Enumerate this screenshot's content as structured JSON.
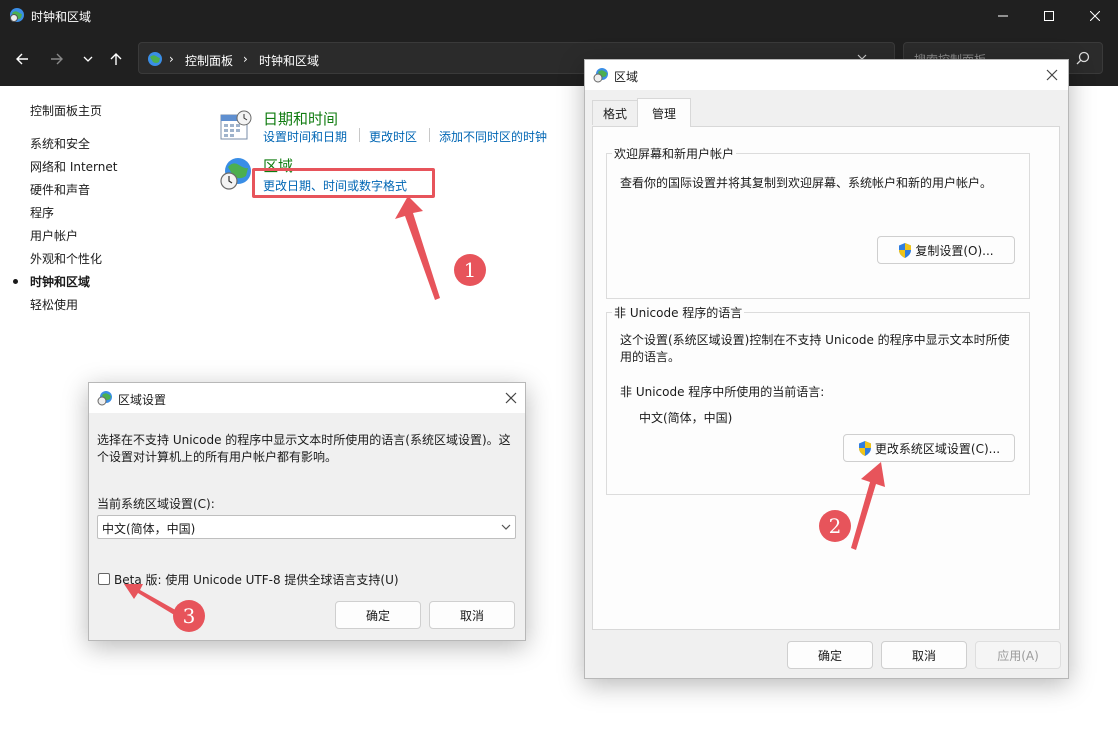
{
  "window": {
    "title": "时钟和区域",
    "breadcrumb": [
      "控制面板",
      "时钟和区域"
    ],
    "search_placeholder": "搜索控制面板"
  },
  "sidebar": {
    "items": [
      {
        "label": "控制面板主页",
        "active": false
      },
      {
        "label": "系统和安全",
        "active": false
      },
      {
        "label": "网络和 Internet",
        "active": false
      },
      {
        "label": "硬件和声音",
        "active": false
      },
      {
        "label": "程序",
        "active": false
      },
      {
        "label": "用户帐户",
        "active": false
      },
      {
        "label": "外观和个性化",
        "active": false
      },
      {
        "label": "时钟和区域",
        "active": true
      },
      {
        "label": "轻松使用",
        "active": false
      }
    ]
  },
  "categories": {
    "datetime": {
      "title": "日期和时间",
      "links": [
        "设置时间和日期",
        "更改时区",
        "添加不同时区的时钟"
      ]
    },
    "region": {
      "title": "区域",
      "link": "更改日期、时间或数字格式"
    }
  },
  "region_dialog": {
    "title": "区域",
    "tabs": [
      "格式",
      "管理"
    ],
    "active_tab": "管理",
    "welcome_group": {
      "legend": "欢迎屏幕和新用户帐户",
      "text": "查看你的国际设置并将其复制到欢迎屏幕、系统帐户和新的用户帐户。",
      "button": "复制设置(O)..."
    },
    "unicode_group": {
      "legend": "非 Unicode 程序的语言",
      "text_line1": "这个设置(系统区域设置)控制在不支持 Unicode 的程序中显示文本时所使",
      "text_line2": "用的语言。",
      "current_label": "非 Unicode 程序中所使用的当前语言:",
      "current_value": "中文(简体，中国)",
      "button": "更改系统区域设置(C)..."
    },
    "buttons": {
      "ok": "确定",
      "cancel": "取消",
      "apply": "应用(A)"
    }
  },
  "locale_dialog": {
    "title": "区域设置",
    "description_line1": "选择在不支持 Unicode 的程序中显示文本时所使用的语言(系统区域设置)。这",
    "description_line2": "个设置对计算机上的所有用户帐户都有影响。",
    "select_label": "当前系统区域设置(C):",
    "select_value": "中文(简体，中国)",
    "beta_label": "Beta 版: 使用 Unicode UTF-8 提供全球语言支持(U)",
    "beta_checked": false,
    "buttons": {
      "ok": "确定",
      "cancel": "取消"
    }
  },
  "annotations": {
    "step1": "1",
    "step2": "2",
    "step3": "3"
  },
  "colors": {
    "annotation_red": "#e7545b",
    "link_blue": "#0066b4",
    "category_green": "#107c10",
    "titlebar_dark": "#202020"
  }
}
